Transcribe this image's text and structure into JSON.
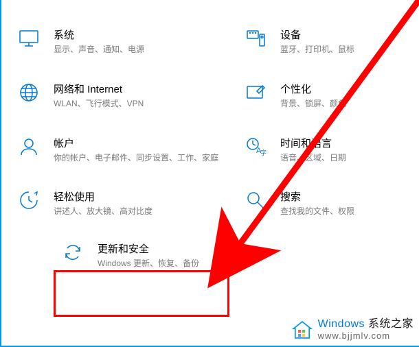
{
  "settings": {
    "system": {
      "title": "系统",
      "desc": "显示、声音、通知、电源"
    },
    "devices": {
      "title": "设备",
      "desc": "蓝牙、打印机、鼠标"
    },
    "network": {
      "title": "网络和 Internet",
      "desc": "WLAN、飞行模式、VPN"
    },
    "personalization": {
      "title": "个性化",
      "desc": "背景、锁屏、颜色"
    },
    "accounts": {
      "title": "帐户",
      "desc": "你的帐户、电子邮件、同步设置、工作、家庭"
    },
    "time_language": {
      "title": "时间和语言",
      "desc": "语音、区域、日期"
    },
    "ease_of_access": {
      "title": "轻松使用",
      "desc": "讲述人、放大镜、高对比度"
    },
    "search": {
      "title": "搜索",
      "desc": "查找我的文件、权限"
    },
    "update_security": {
      "title": "更新和安全",
      "desc": "Windows 更新、恢复、备份"
    }
  },
  "watermark": {
    "title_part1": "Windows",
    "title_part2": "系统之家",
    "url": "www.bjjmlv.com"
  }
}
